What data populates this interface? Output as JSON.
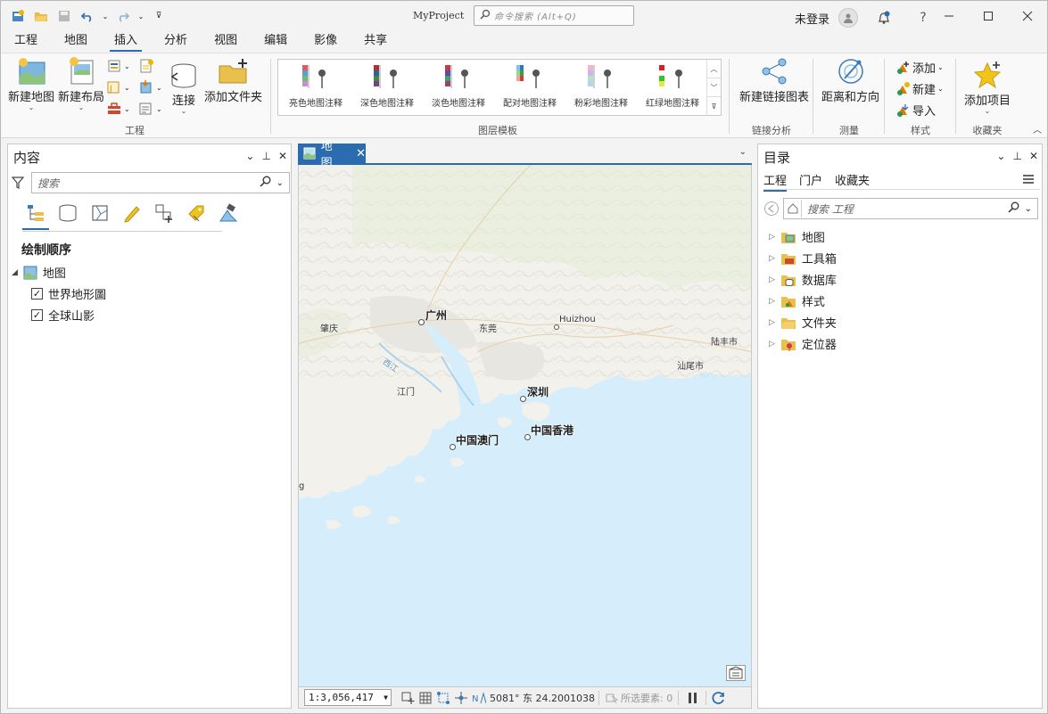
{
  "title": "MyProject",
  "command_search": {
    "placeholder": "命令搜索 (Alt+Q)"
  },
  "user": {
    "name": "未登录",
    "help": "?"
  },
  "ribbon_tabs": [
    "工程",
    "地图",
    "插入",
    "分析",
    "视图",
    "编辑",
    "影像",
    "共享"
  ],
  "active_tab": "插入",
  "ribbon": {
    "project_group": {
      "label": "工程",
      "new_map": "新建地图",
      "new_layout": "新建布局",
      "connect": "连接",
      "add_folder": "添加文件夹"
    },
    "layer_templates": {
      "label": "图层模板",
      "items": [
        "亮色地图注释",
        "深色地图注释",
        "淡色地图注释",
        "配对地图注释",
        "粉彩地图注释",
        "红绿地图注释"
      ]
    },
    "link_analysis": {
      "label": "链接分析",
      "new_link_chart": "新建链接图表"
    },
    "measure": {
      "label": "测量",
      "distance_direction": "距离和方向"
    },
    "styles": {
      "label": "样式",
      "add": "添加",
      "new": "新建",
      "import": "导入"
    },
    "favorites": {
      "label": "收藏夹",
      "add_item": "添加项目"
    }
  },
  "contents": {
    "title": "内容",
    "search_placeholder": "搜索",
    "drawing_order": "绘制顺序",
    "map_name": "地图",
    "layers": [
      {
        "name": "世界地形圖",
        "checked": true
      },
      {
        "name": "全球山影",
        "checked": true
      }
    ]
  },
  "map": {
    "tab_label": "地图",
    "labels": {
      "guangzhou": "广州",
      "zhaoqing": "肇庆",
      "dongguan": "东莞",
      "huizhou": "Huizhou",
      "lufeng": "陆丰市",
      "shanwei": "汕尾市",
      "jiangmen": "江门",
      "shenzhen": "深圳",
      "macau": "中国澳门",
      "hongkong": "中国香港",
      "xijiang": "西江",
      "edge_g": "g"
    },
    "scale": "1:3,056,417",
    "coords": "5081° 东 24.2001038",
    "selected_features": "所选要素: 0"
  },
  "catalog": {
    "title": "目录",
    "tabs": [
      "工程",
      "门户",
      "收藏夹"
    ],
    "active_tab": "工程",
    "search_placeholder": "搜索 工程",
    "items": [
      "地图",
      "工具箱",
      "数据库",
      "样式",
      "文件夹",
      "定位器"
    ]
  },
  "colors": {
    "accent": "#2b6cb0",
    "water": "#d6eefb",
    "land": "#f2f1ec"
  }
}
